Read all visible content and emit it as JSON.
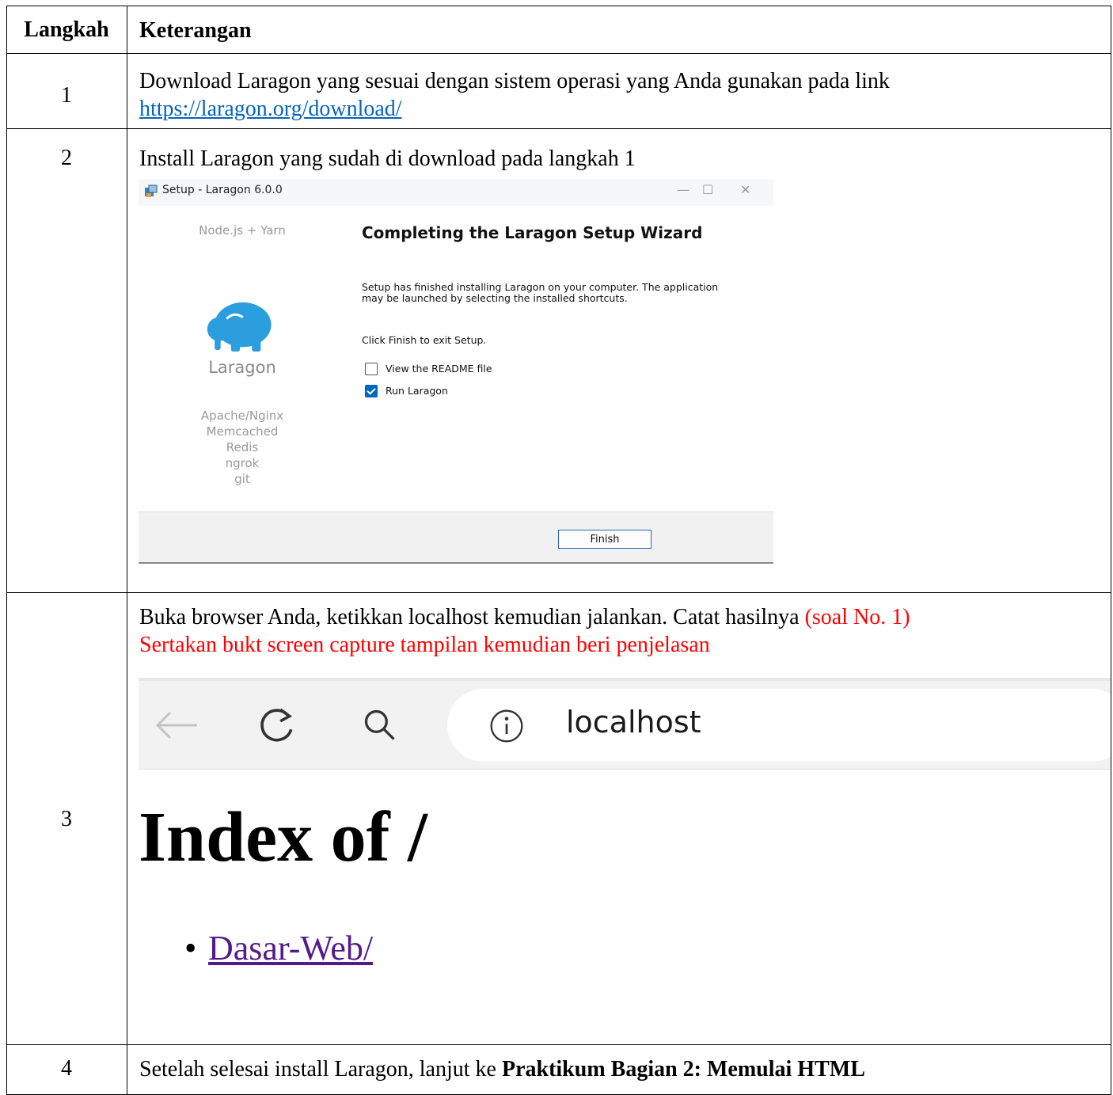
{
  "table": {
    "headers": {
      "step": "Langkah",
      "desc": "Keterangan"
    },
    "rows": [
      {
        "step": "1",
        "text": "Download Laragon yang sesuai dengan sistem operasi yang Anda gunakan pada link",
        "link": "https://laragon.org/download/"
      },
      {
        "step": "2",
        "text": "Install Laragon yang sudah di download pada langkah 1"
      },
      {
        "step": "3",
        "text": "Buka browser Anda, ketikkan localhost kemudian jalankan. Catat hasilnya",
        "note_inline": "(soal No. 1)",
        "note_line": "Sertakan bukt screen capture tampilan kemudian beri penjelasan"
      },
      {
        "step": "4",
        "text": "Setelah selesai install Laragon, lanjut ke",
        "bold": "Praktikum Bagian 2: Memulai HTML"
      }
    ]
  },
  "wizard": {
    "title": "Setup - Laragon 6.0.0",
    "window_controls": {
      "minimize": "—",
      "maximize": "☐",
      "close": "✕"
    },
    "side_top": "Node.js + Yarn",
    "logo_word": "Laragon",
    "side_stack": [
      "Apache/Nginx",
      "Memcached",
      "Redis",
      "ngrok",
      "git"
    ],
    "heading": "Completing the Laragon Setup Wizard",
    "body": "Setup has finished installing Laragon on your computer. The application may be launched by selecting the installed shortcuts.",
    "body2": "Click Finish to exit Setup.",
    "checkboxes": [
      {
        "label": "View the README file",
        "checked": false
      },
      {
        "label": "Run Laragon",
        "checked": true
      }
    ],
    "finish_label": "Finish",
    "accent": "#0067c0"
  },
  "browser": {
    "address": "localhost",
    "icons": [
      "back-arrow-icon",
      "reload-icon",
      "search-icon",
      "info-icon"
    ],
    "heading": "Index of /",
    "entries": [
      "Dasar-Web/"
    ],
    "link_color": "#551a8b"
  },
  "colors": {
    "red_note": "#ff0000",
    "link": "#0563c1"
  }
}
